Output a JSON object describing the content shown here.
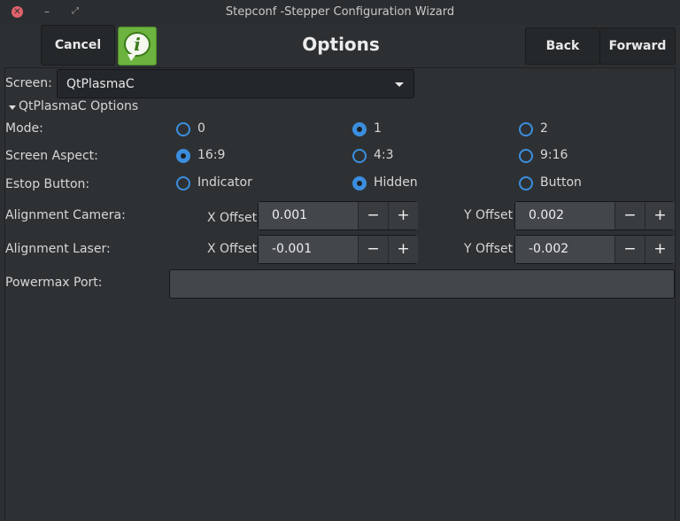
{
  "window": {
    "title": "Stepconf -Stepper Configuration Wizard",
    "close_glyph": "✕",
    "minimize_glyph": "–",
    "maximize_glyph": "⤢"
  },
  "header": {
    "cancel_label": "Cancel",
    "info_glyph": "i",
    "title": "Options",
    "back_label": "Back",
    "forward_label": "Forward"
  },
  "screen": {
    "label": "Screen:",
    "selected": "QtPlasmaC"
  },
  "options_section": {
    "label": "QtPlasmaC Options",
    "expanded": true
  },
  "mode": {
    "label": "Mode:",
    "options": [
      "0",
      "1",
      "2"
    ],
    "selected": "1"
  },
  "screen_aspect": {
    "label": "Screen Aspect:",
    "options": [
      "16:9",
      "4:3",
      "9:16"
    ],
    "selected": "16:9"
  },
  "estop_button": {
    "label": "Estop Button:",
    "options": [
      "Indicator",
      "Hidden",
      "Button"
    ],
    "selected": "Hidden"
  },
  "alignment_camera": {
    "label": "Alignment Camera:",
    "x_label": "X Offset",
    "x_value": "0.001",
    "y_label": "Y Offset",
    "y_value": "0.002"
  },
  "alignment_laser": {
    "label": "Alignment Laser:",
    "x_label": "X Offset",
    "x_value": "-0.001",
    "y_label": "Y Offset",
    "y_value": "-0.002"
  },
  "powermax_port": {
    "label": "Powermax Port:",
    "value": ""
  },
  "spin": {
    "minus": "−",
    "plus": "+"
  },
  "colors": {
    "accent": "#3b8ede",
    "background": "#2e3134",
    "info_green": "#6cb33f"
  }
}
